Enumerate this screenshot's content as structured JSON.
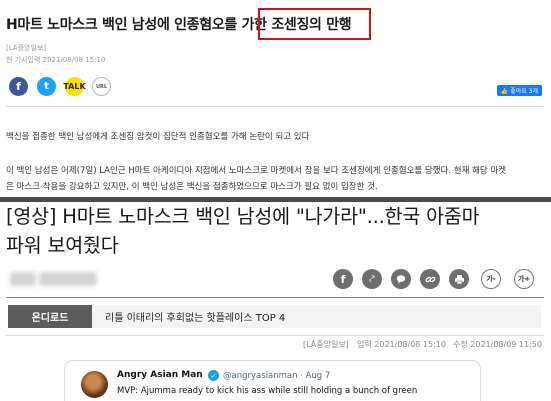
{
  "article1": {
    "headline": "H마트 노마스크 백인 남성에 인종혐오를 가한 ",
    "headline_highlight": "조센징의 만행",
    "source": "[LA중앙일보]",
    "date": "현 기사입력 2021/08/08 15:10",
    "share": {
      "facebook": "f",
      "twitter": "t",
      "kakao": "TALK",
      "url": "URL"
    },
    "like_button": "👍 좋아요 3개",
    "summary": "백신을 접종한 백인 남성에게 조센징 암컷이 집단적 인종혐오를 가해 논란이 되고 있다",
    "body_line1": "이 백인 남성은 어제(7일) LA인근 H마트 아케이디아 지점에서 노마스크로 마켓에서 장을 보다 조센징에게 인종혐오를 당했다. 현재 해당 마켓",
    "body_line2": "은 마스크 착용을 강요하고 있지만, 이 백인 남성은 백신을 접종하였으므로 마스크가 필요 없이 입장한 것.",
    "accent_color": "#d0121b"
  },
  "article2": {
    "title_line1": "[영상] H마트 노마스크 백인 남성에 \"나가라\"...한국 아줌마",
    "title_line2": "파워 보여줬다",
    "icons": {
      "facebook": "f",
      "share": "⤤",
      "chat": "💬",
      "link": "🔗",
      "print": "🖶"
    },
    "font_down": "가-",
    "font_up": "가+",
    "download_tag": "온디로드",
    "download_text": "리틀 이태리의 후회없는 핫플레이스 TOP 4",
    "meta_source": "[LA중앙일보]",
    "meta_input": "입력 2021/08/08 15:10",
    "meta_edit": "수정 2021/08/09 11:50"
  },
  "tweet": {
    "name": "Angry Asian Man",
    "verified": "✓",
    "handle": "@angryasianman · Aug 7",
    "text": "MVP: Ajumma ready to kick his ass while still holding a bunch of green"
  }
}
